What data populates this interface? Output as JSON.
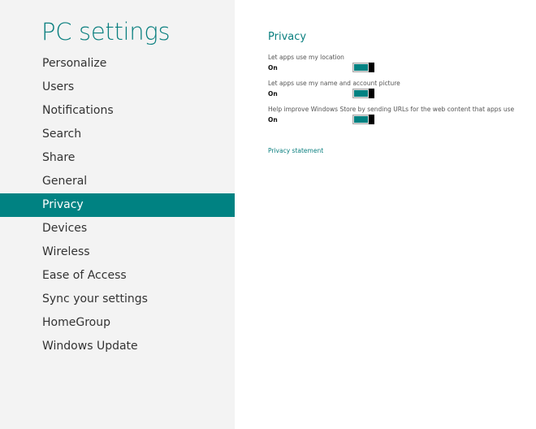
{
  "app_title": "PC settings",
  "nav": {
    "items": [
      {
        "label": "Personalize"
      },
      {
        "label": "Users"
      },
      {
        "label": "Notifications"
      },
      {
        "label": "Search"
      },
      {
        "label": "Share"
      },
      {
        "label": "General"
      },
      {
        "label": "Privacy",
        "active": true
      },
      {
        "label": "Devices"
      },
      {
        "label": "Wireless"
      },
      {
        "label": "Ease of Access"
      },
      {
        "label": "Sync your settings"
      },
      {
        "label": "HomeGroup"
      },
      {
        "label": "Windows Update"
      }
    ]
  },
  "privacy": {
    "title": "Privacy",
    "settings": [
      {
        "label": "Let apps use my location",
        "state": "On",
        "on": true
      },
      {
        "label": "Let apps use my name and account picture",
        "state": "On",
        "on": true
      },
      {
        "label": "Help improve Windows Store by sending URLs for the web content that apps use",
        "state": "On",
        "on": true
      }
    ],
    "privacy_statement_link": "Privacy statement"
  },
  "colors": {
    "accent": "#008282",
    "sidebar_bg": "#f3f3f3"
  }
}
